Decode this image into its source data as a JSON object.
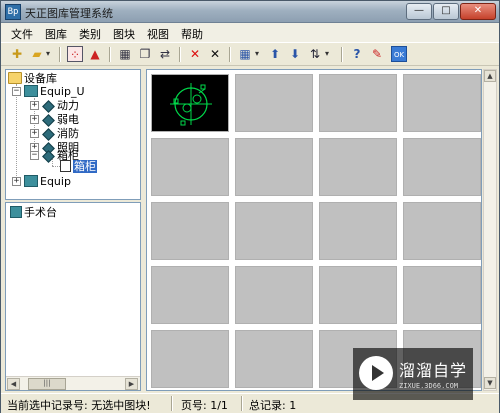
{
  "window": {
    "title": "天正图库管理系统",
    "app_icon": "Bp",
    "icon": "app-icon"
  },
  "titlebar": {
    "minimize": "—",
    "maximize": "□",
    "close": "✕"
  },
  "menu": [
    "文件",
    "图库",
    "类别",
    "图块",
    "视图",
    "帮助"
  ],
  "toolbar": {
    "icons": [
      "new-icon",
      "open-icon",
      "select-all-icon",
      "warning-icon",
      "block-icon",
      "copy-icon",
      "replace-icon",
      "delete-icon",
      "close-x-icon",
      "layout-icon",
      "up-arrow-icon",
      "down-arrow-icon",
      "sort-icon",
      "help-icon",
      "edit-icon",
      "ok-icon"
    ],
    "dropdown_glyph": "▾"
  },
  "tree": {
    "root": "设备库",
    "libraries": [
      {
        "name": "Equip_U",
        "expanded": true,
        "children": [
          {
            "name": "动力",
            "expanded": false
          },
          {
            "name": "弱电",
            "expanded": false
          },
          {
            "name": "消防",
            "expanded": false
          },
          {
            "name": "照明",
            "expanded": false
          },
          {
            "name": "箱柜",
            "expanded": true,
            "children": [
              "箱柜"
            ]
          }
        ]
      },
      {
        "name": "Equip",
        "expanded": false
      }
    ]
  },
  "bench": {
    "label": "手术台"
  },
  "scrollbar": {
    "left": "◀",
    "thumb": "|||",
    "right": "▶",
    "up": "▲",
    "down": "▼"
  },
  "grid": {
    "rows": 5,
    "cols": 4,
    "preview_cell": 0,
    "preview_color": "#00d84a",
    "background": "#c0c0c0"
  },
  "status": {
    "current": "当前选中记录号: 无选中图块!",
    "page": "页号: 1/1",
    "total": "总记录:  1"
  },
  "watermark": {
    "title": "溜溜自学",
    "sub": "ZIXUE.3D66.COM"
  }
}
